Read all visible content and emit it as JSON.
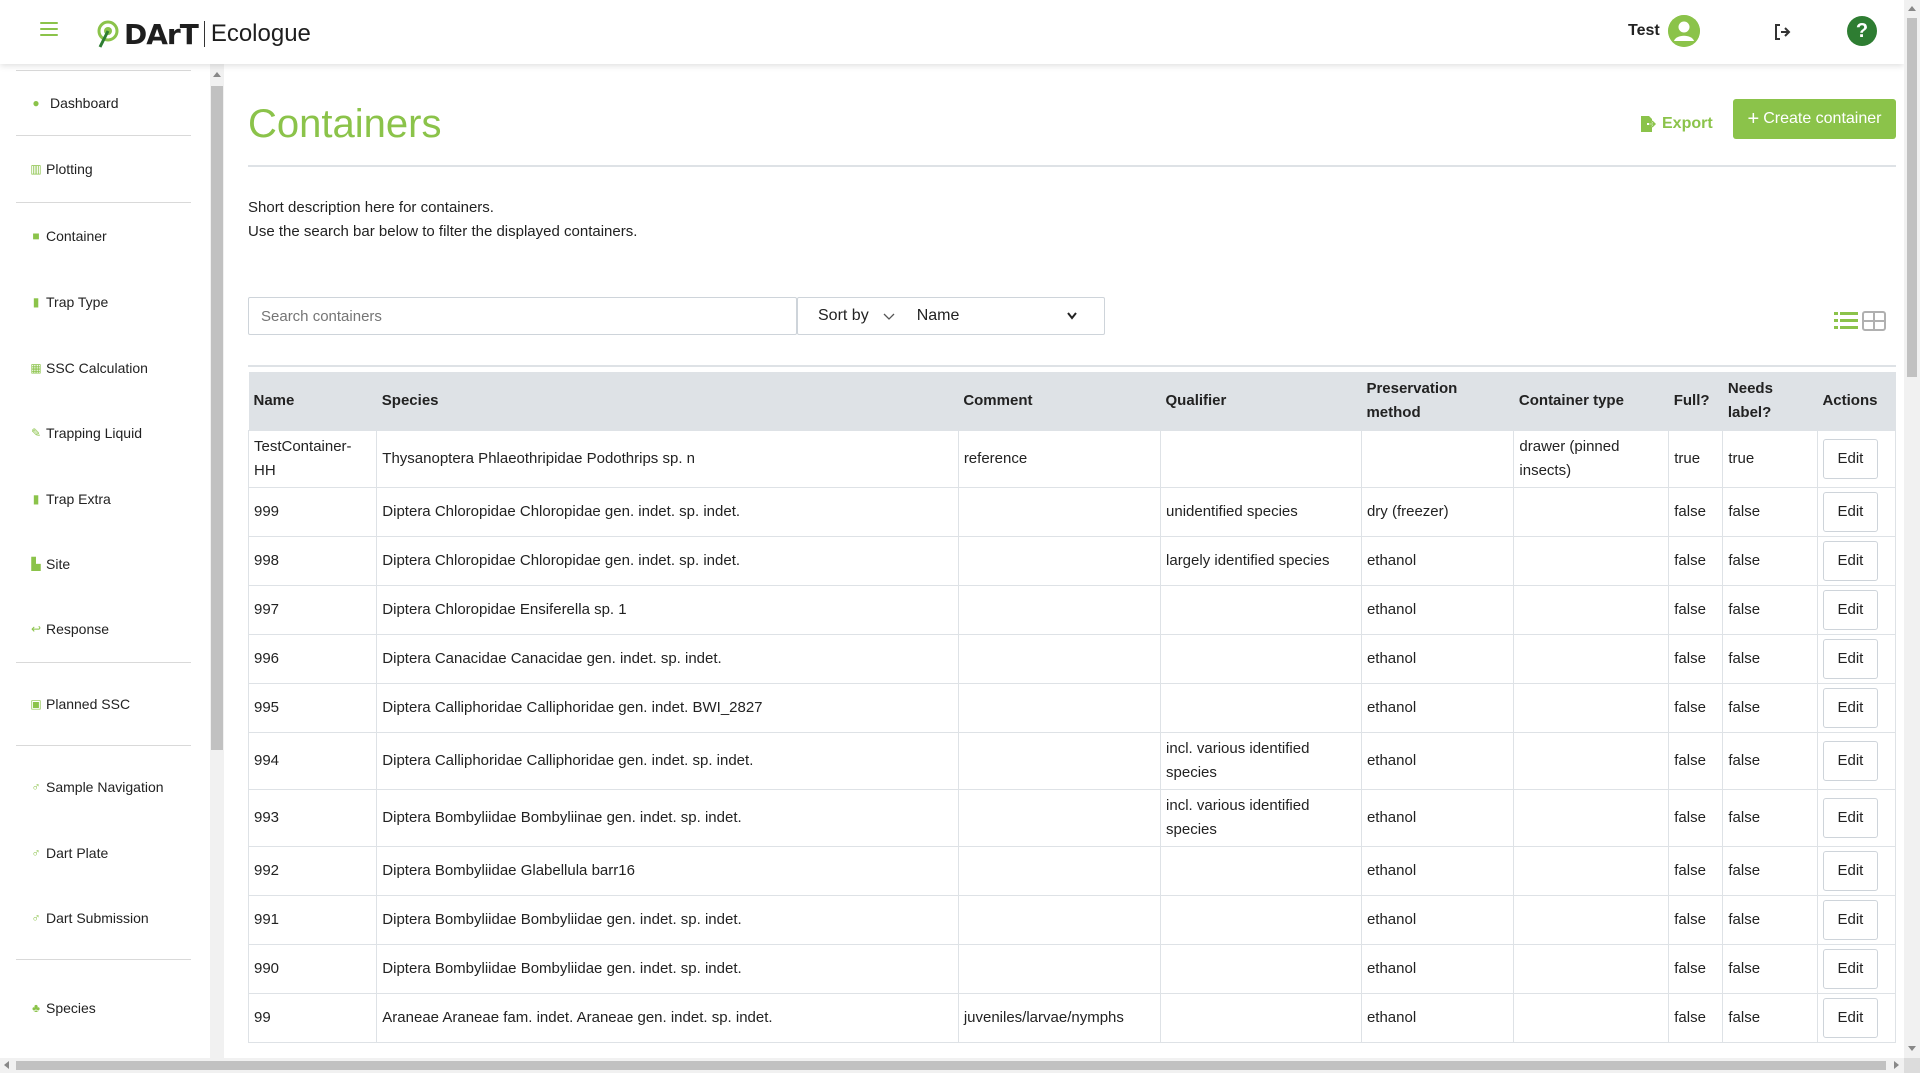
{
  "brand": {
    "name": "DArT",
    "app": "Ecologue",
    "accent": "#8bc34a"
  },
  "header": {
    "user_name": "Test",
    "help_label": "?"
  },
  "sidebar": {
    "items": [
      {
        "label": "Dashboard",
        "icon": "dashboard-icon"
      },
      {
        "label": "Plotting",
        "icon": "chart-icon"
      },
      {
        "label": "Container",
        "icon": "container-icon"
      },
      {
        "label": "Trap Type",
        "icon": "trash-icon"
      },
      {
        "label": "SSC Calculation",
        "icon": "calculator-icon"
      },
      {
        "label": "Trapping Liquid",
        "icon": "pipette-icon"
      },
      {
        "label": "Trap Extra",
        "icon": "trash-icon"
      },
      {
        "label": "Site",
        "icon": "map-icon"
      },
      {
        "label": "Response",
        "icon": "reply-icon"
      },
      {
        "label": "Planned SSC",
        "icon": "calendar-icon"
      },
      {
        "label": "Sample Navigation",
        "icon": "flask-icon"
      },
      {
        "label": "Dart Plate",
        "icon": "flask-icon"
      },
      {
        "label": "Dart Submission",
        "icon": "flask-icon"
      },
      {
        "label": "Species",
        "icon": "species-icon"
      }
    ]
  },
  "page": {
    "title": "Containers",
    "export_label": "Export",
    "create_label": "Create container",
    "description_line1": "Short description here for containers.",
    "description_line2": "Use the search bar below to filter the displayed containers.",
    "search_placeholder": "Search containers",
    "sort_label": "Sort by",
    "sort_value": "Name"
  },
  "table": {
    "headers": {
      "name": "Name",
      "species": "Species",
      "comment": "Comment",
      "qualifier": "Qualifier",
      "preservation_1": "Preservation",
      "preservation_2": "method",
      "container_type": "Container type",
      "full": "Full?",
      "needs_label_1": "Needs",
      "needs_label_2": "label?",
      "actions": "Actions"
    },
    "edit_label": "Edit",
    "rows": [
      {
        "name": "TestContainer-HH",
        "species": "Thysanoptera Phlaeothripidae Podothrips sp. n",
        "comment": "reference",
        "qualifier": "",
        "preservation": "",
        "container_type": "drawer (pinned insects)",
        "full": "true",
        "needs_label": "true"
      },
      {
        "name": "999",
        "species": "Diptera Chloropidae Chloropidae gen. indet. sp. indet.",
        "comment": "",
        "qualifier": "unidentified species",
        "preservation": "dry (freezer)",
        "container_type": "",
        "full": "false",
        "needs_label": "false"
      },
      {
        "name": "998",
        "species": "Diptera Chloropidae Chloropidae gen. indet. sp. indet.",
        "comment": "",
        "qualifier": "largely identified species",
        "preservation": "ethanol",
        "container_type": "",
        "full": "false",
        "needs_label": "false"
      },
      {
        "name": "997",
        "species": "Diptera Chloropidae Ensiferella sp. 1",
        "comment": "",
        "qualifier": "",
        "preservation": "ethanol",
        "container_type": "",
        "full": "false",
        "needs_label": "false"
      },
      {
        "name": "996",
        "species": "Diptera Canacidae Canacidae gen. indet. sp. indet.",
        "comment": "",
        "qualifier": "",
        "preservation": "ethanol",
        "container_type": "",
        "full": "false",
        "needs_label": "false"
      },
      {
        "name": "995",
        "species": "Diptera Calliphoridae Calliphoridae gen. indet. BWI_2827",
        "comment": "",
        "qualifier": "",
        "preservation": "ethanol",
        "container_type": "",
        "full": "false",
        "needs_label": "false"
      },
      {
        "name": "994",
        "species": "Diptera Calliphoridae Calliphoridae gen. indet. sp. indet.",
        "comment": "",
        "qualifier": "incl. various identified species",
        "preservation": "ethanol",
        "container_type": "",
        "full": "false",
        "needs_label": "false"
      },
      {
        "name": "993",
        "species": "Diptera Bombyliidae Bombyliinae gen. indet. sp. indet.",
        "comment": "",
        "qualifier": "incl. various identified species",
        "preservation": "ethanol",
        "container_type": "",
        "full": "false",
        "needs_label": "false"
      },
      {
        "name": "992",
        "species": "Diptera Bombyliidae Glabellula barr16",
        "comment": "",
        "qualifier": "",
        "preservation": "ethanol",
        "container_type": "",
        "full": "false",
        "needs_label": "false"
      },
      {
        "name": "991",
        "species": "Diptera Bombyliidae Bombyliidae gen. indet. sp. indet.",
        "comment": "",
        "qualifier": "",
        "preservation": "ethanol",
        "container_type": "",
        "full": "false",
        "needs_label": "false"
      },
      {
        "name": "990",
        "species": "Diptera Bombyliidae Bombyliidae gen. indet. sp. indet.",
        "comment": "",
        "qualifier": "",
        "preservation": "ethanol",
        "container_type": "",
        "full": "false",
        "needs_label": "false"
      },
      {
        "name": "99",
        "species": "Araneae Araneae fam. indet. Araneae gen. indet. sp. indet.",
        "comment": "juveniles/larvae/nymphs",
        "qualifier": "",
        "preservation": "ethanol",
        "container_type": "",
        "full": "false",
        "needs_label": "false"
      }
    ]
  }
}
